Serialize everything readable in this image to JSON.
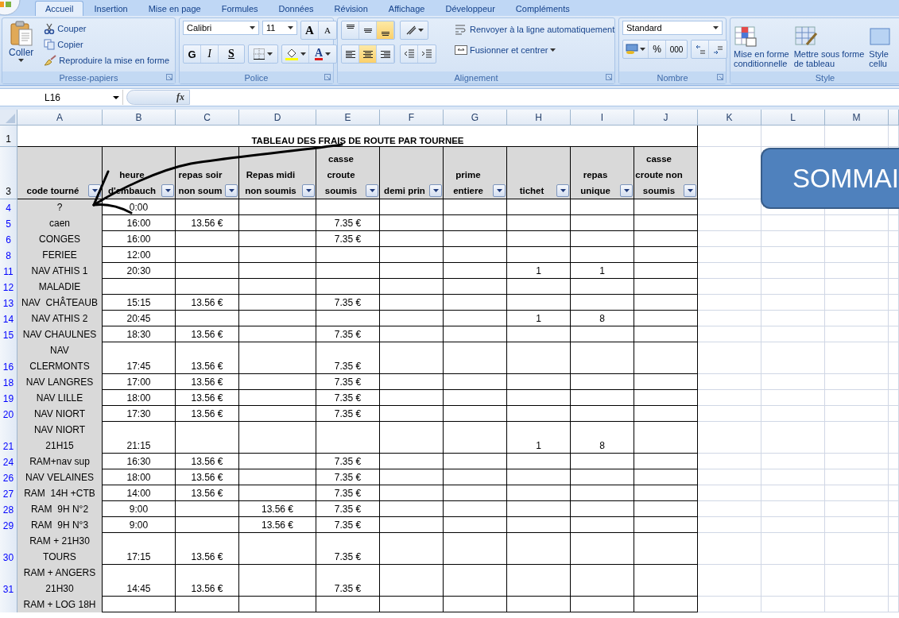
{
  "ribbon": {
    "tabs": [
      {
        "label": "Accueil",
        "selected": true
      },
      {
        "label": "Insertion",
        "selected": false
      },
      {
        "label": "Mise en page",
        "selected": false
      },
      {
        "label": "Formules",
        "selected": false
      },
      {
        "label": "Données",
        "selected": false
      },
      {
        "label": "Révision",
        "selected": false
      },
      {
        "label": "Affichage",
        "selected": false
      },
      {
        "label": "Développeur",
        "selected": false
      },
      {
        "label": "Compléments",
        "selected": false
      }
    ],
    "clipboard": {
      "title": "Presse-papiers",
      "paste": "Coller",
      "cut": "Couper",
      "copy": "Copier",
      "format_painter": "Reproduire la mise en forme"
    },
    "font": {
      "title": "Police",
      "font_name": "Calibri",
      "font_size": "11",
      "grow": "A",
      "shrink": "A",
      "bold": "G",
      "italic": "I",
      "underline": "S",
      "font_color": "A"
    },
    "alignment": {
      "title": "Alignement",
      "vertical": [
        {
          "kind": "top",
          "selected": false
        },
        {
          "kind": "middle",
          "selected": false
        },
        {
          "kind": "bottom",
          "selected": true
        }
      ],
      "horizontal": [
        {
          "kind": "left",
          "selected": false
        },
        {
          "kind": "center",
          "selected": true
        },
        {
          "kind": "right",
          "selected": false
        }
      ],
      "wrap": "Renvoyer à la ligne automatiquement",
      "merge": "Fusionner et centrer"
    },
    "number": {
      "title": "Nombre",
      "format": "Standard",
      "percent": "%",
      "thousands": "000"
    },
    "style": {
      "title": "Style",
      "buttons": [
        {
          "kind": "conditional",
          "label": "Mise en forme\nconditionnelle"
        },
        {
          "kind": "table",
          "label": "Mettre sous forme\nde tableau"
        },
        {
          "kind": "cell",
          "label": "Style\ncellu"
        }
      ]
    }
  },
  "formula_bar": {
    "name_box": "L16",
    "fx": "fx"
  },
  "sheet": {
    "columns": [
      "A",
      "B",
      "C",
      "D",
      "E",
      "F",
      "G",
      "H",
      "I",
      "J",
      "K",
      "L",
      "M"
    ],
    "title_row": "1",
    "title": "TABLEAU DES FRAIS DE ROUTE PAR TOURNEE",
    "header_row": "3",
    "headers": [
      "code tourné",
      "heure\nd'embauch",
      "repas soir\nnon soum",
      "Repas midi\nnon soumis",
      "casse\ncroute\nsoumis",
      "demi prin",
      "prime\nentiere",
      "tichet",
      "repas\nunique",
      "casse\ncroute non\nsoumis"
    ],
    "filtered": true,
    "rows": [
      {
        "row": "4",
        "a": "?",
        "b": "0:00"
      },
      {
        "row": "5",
        "a": "caen",
        "b": "16:00",
        "c": "13.56 €",
        "e": "7.35 €"
      },
      {
        "row": "6",
        "a": "CONGES",
        "b": "16:00",
        "e": "7.35 €"
      },
      {
        "row": "8",
        "a": "FERIEE",
        "b": "12:00"
      },
      {
        "row": "11",
        "a": "NAV ATHIS 1",
        "b": "20:30",
        "h": "1",
        "i": "1"
      },
      {
        "row": "12",
        "a": "MALADIE"
      },
      {
        "row": "13",
        "a": "NAV  CHÂTEAUB",
        "b": "15:15",
        "c": "13.56 €",
        "e": "7.35 €"
      },
      {
        "row": "14",
        "a": "NAV ATHIS 2",
        "b": "20:45",
        "h": "1",
        "i": "8"
      },
      {
        "row": "15",
        "a": "NAV CHAULNES",
        "b": "18:30",
        "c": "13.56 €",
        "e": "7.35 €"
      },
      {
        "row": "16",
        "a": "NAV\nCLERMONTS",
        "b": "17:45",
        "c": "13.56 €",
        "e": "7.35 €"
      },
      {
        "row": "18",
        "a": "NAV LANGRES",
        "b": "17:00",
        "c": "13.56 €",
        "e": "7.35 €"
      },
      {
        "row": "19",
        "a": "NAV LILLE",
        "b": "18:00",
        "c": "13.56 €",
        "e": "7.35 €"
      },
      {
        "row": "20",
        "a": "NAV NIORT",
        "b": "17:30",
        "c": "13.56 €",
        "e": "7.35 €"
      },
      {
        "row": "21",
        "a": "NAV NIORT\n21H15",
        "b": "21:15",
        "h": "1",
        "i": "8"
      },
      {
        "row": "24",
        "a": "RAM+nav sup",
        "b": "16:30",
        "c": "13.56 €",
        "e": "7.35 €"
      },
      {
        "row": "26",
        "a": "NAV VELAINES",
        "b": "18:00",
        "c": "13.56 €",
        "e": "7.35 €"
      },
      {
        "row": "27",
        "a": "RAM  14H +CTB",
        "b": "14:00",
        "c": "13.56 €",
        "e": "7.35 €"
      },
      {
        "row": "28",
        "a": "RAM  9H N°2",
        "b": "9:00",
        "d": "13.56 €",
        "e": "7.35 €"
      },
      {
        "row": "29",
        "a": "RAM  9H N°3",
        "b": "9:00",
        "d": "13.56 €",
        "e": "7.35 €"
      },
      {
        "row": "30",
        "a": "RAM + 21H30\nTOURS",
        "b": "17:15",
        "c": "13.56 €",
        "e": "7.35 €"
      },
      {
        "row": "31",
        "a": "RAM + ANGERS\n21H30",
        "b": "14:45",
        "c": "13.56 €",
        "e": "7.35 €"
      },
      {
        "a": "RAM + LOG 18H"
      }
    ],
    "shape": {
      "label": "SOMMAI"
    }
  }
}
